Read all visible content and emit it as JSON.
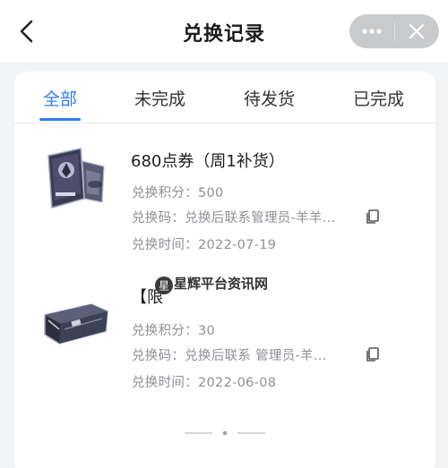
{
  "header": {
    "title": "兑换记录",
    "back_icon": "chevron-left-icon",
    "more_icon": "more-dots-icon",
    "close_icon": "close-icon"
  },
  "tabs": [
    {
      "label": "全部",
      "active": true
    },
    {
      "label": "未完成",
      "active": false
    },
    {
      "label": "待发货",
      "active": false
    },
    {
      "label": "已完成",
      "active": false
    }
  ],
  "records": [
    {
      "title": "680点券（周1补货）",
      "points_label": "兑换积分：",
      "points": "500",
      "code_label": "兑换码：",
      "code": "兑换后联系管理员-羊羊...",
      "time_label": "兑换时间：",
      "time": "2022-07-19"
    },
    {
      "title": "【限",
      "points_label": "兑换积分：",
      "points": "30",
      "code_label": "兑换码：",
      "code": "兑换后联系 管理员-羊...",
      "time_label": "兑换时间：",
      "time": "2022-06-08"
    }
  ],
  "watermark": "星辉平台资讯网",
  "colors": {
    "accent": "#2f7cf6",
    "background": "#f2f3f5",
    "meta_text": "#8d8f94"
  }
}
